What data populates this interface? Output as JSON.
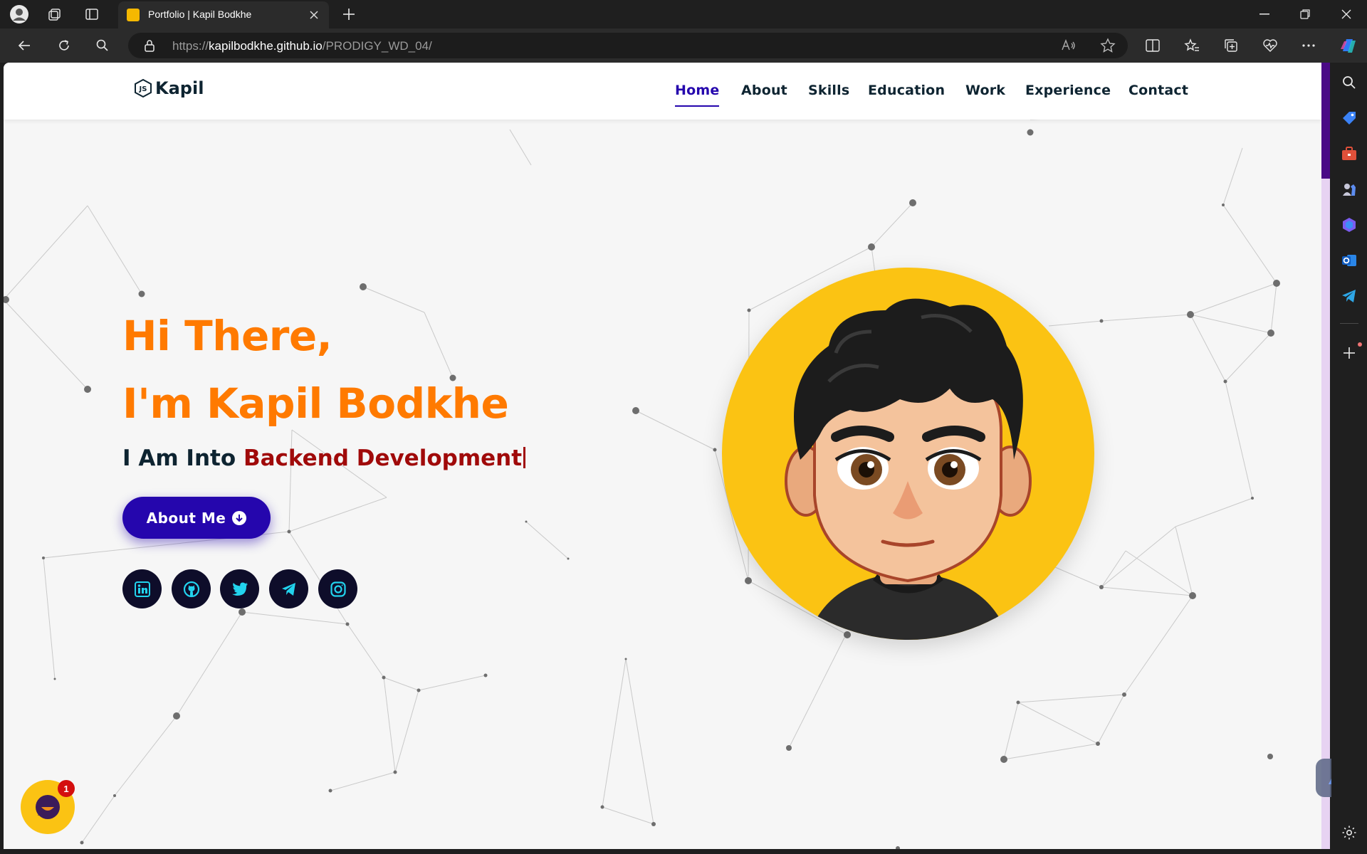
{
  "browser": {
    "tab_title": "Portfolio | Kapil Bodkhe",
    "url_scheme": "https://",
    "url_host": "kapilbodkhe.github.io",
    "url_path": "/PRODIGY_WD_04/"
  },
  "site": {
    "logo_text": "Kapil",
    "nav": [
      {
        "label": "Home",
        "active": true
      },
      {
        "label": "About"
      },
      {
        "label": "Skills"
      },
      {
        "label": "Education"
      },
      {
        "label": "Work"
      },
      {
        "label": "Experience"
      },
      {
        "label": "Contact"
      }
    ]
  },
  "hero": {
    "line1": "Hi There,",
    "line2": "I'm Kapil Bodkhe",
    "sub_prefix": "I Am Into",
    "sub_typed": "Backend Development",
    "button_label": "About Me",
    "socials": [
      "linkedin-icon",
      "github-icon",
      "twitter-icon",
      "telegram-icon",
      "instagram-icon"
    ]
  },
  "chat": {
    "badge_count": "1"
  },
  "colors": {
    "accent_orange": "#ff7a00",
    "brand_blue": "#2506ad",
    "accent_red": "#a00a0a",
    "avatar_bg": "#fbc313"
  }
}
